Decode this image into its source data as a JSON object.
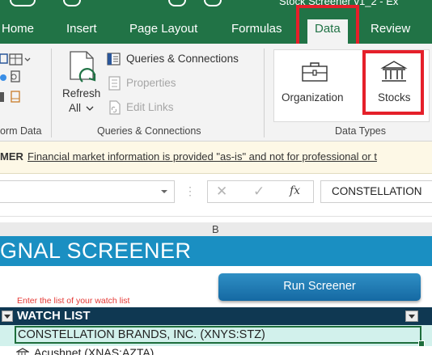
{
  "window": {
    "title": "Stock Screener v1_2 - Ex"
  },
  "tabs": [
    "Home",
    "Insert",
    "Page Layout",
    "Formulas",
    "Data",
    "Review"
  ],
  "ribbon": {
    "get_data_group_label": "orm Data",
    "queries_group": {
      "refresh_line1": "Refresh",
      "refresh_line2": "All",
      "queries_connections": "Queries & Connections",
      "properties": "Properties",
      "edit_links": "Edit Links",
      "label": "Queries & Connections"
    },
    "data_types_group": {
      "organization": "Organization",
      "stocks": "Stocks",
      "label": "Data Types"
    }
  },
  "message_bar": {
    "prefix": "MER",
    "text": "Financial market information is provided \"as-is\" and not for professional or t"
  },
  "formula_bar": {
    "fx": "fx",
    "content": "CONSTELLATION"
  },
  "column_header": "B",
  "sheet": {
    "banner_title": "GNAL SCREENER",
    "run_button": "Run Screener",
    "hint": "Enter the list of your watch list",
    "watch_list_header": "WATCH LIST",
    "watch_list_items": [
      "CONSTELLATION BRANDS, INC. (XNYS:STZ)",
      "Acushnet (XNAS:AZTA)"
    ]
  },
  "colors": {
    "excel_green": "#217346",
    "ribbon_bg": "#f3f3f3",
    "highlight_red": "#e5202a",
    "banner_blue": "#1a8fc2",
    "watch_header_navy": "#0f3852",
    "watch_row_teal": "#d2f1ec",
    "hint_red": "#e53935"
  }
}
